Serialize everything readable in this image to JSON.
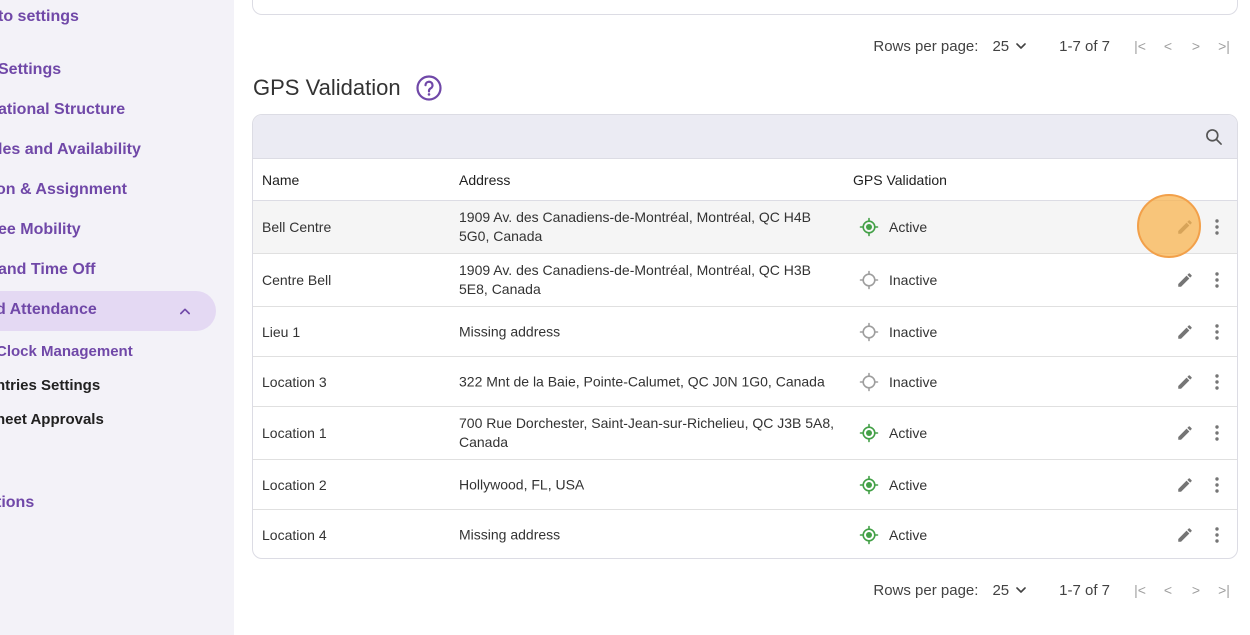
{
  "sidebar": {
    "back_label": "to settings",
    "items": [
      {
        "label": "Settings"
      },
      {
        "label": "ational Structure"
      },
      {
        "label": "les and Availability"
      },
      {
        "label": "on & Assignment"
      },
      {
        "label": "ee Mobility"
      },
      {
        "label": "and Time Off"
      },
      {
        "label": "d Attendance"
      }
    ],
    "subitems": [
      {
        "label": "Clock Management"
      },
      {
        "label": "ntries Settings"
      },
      {
        "label": "heet Approvals"
      }
    ],
    "bottom_item": "tions"
  },
  "top_pagination": {
    "rows_per_page_label": "Rows per page:",
    "rows_per_page_value": "25",
    "range": "1-7 of 7"
  },
  "section": {
    "title": "GPS Validation"
  },
  "table": {
    "columns": [
      "Name",
      "Address",
      "GPS Validation"
    ],
    "rows": [
      {
        "name": "Bell Centre",
        "address": "1909 Av. des Canadiens-de-Montréal, Montréal, QC H4B 5G0, Canada",
        "status": "Active"
      },
      {
        "name": "Centre Bell",
        "address": "1909 Av. des Canadiens-de-Montréal, Montréal, QC H3B 5E8, Canada",
        "status": "Inactive"
      },
      {
        "name": "Lieu 1",
        "address": "Missing address",
        "status": "Inactive"
      },
      {
        "name": "Location 3",
        "address": "322 Mnt de la Baie, Pointe-Calumet, QC J0N 1G0, Canada",
        "status": "Inactive"
      },
      {
        "name": "Location 1",
        "address": "700 Rue Dorchester, Saint-Jean-sur-Richelieu, QC J3B 5A8, Canada",
        "status": "Active"
      },
      {
        "name": "Location 2",
        "address": "Hollywood, FL, USA",
        "status": "Active"
      },
      {
        "name": "Location 4",
        "address": "Missing address",
        "status": "Active"
      }
    ]
  },
  "bottom_pagination": {
    "rows_per_page_label": "Rows per page:",
    "rows_per_page_value": "25",
    "range": "1-7 of 7"
  },
  "colors": {
    "accent": "#7048a8",
    "active_status": "#43a047",
    "inactive_status": "#9e9e9e",
    "highlight": "#f2a04a"
  }
}
